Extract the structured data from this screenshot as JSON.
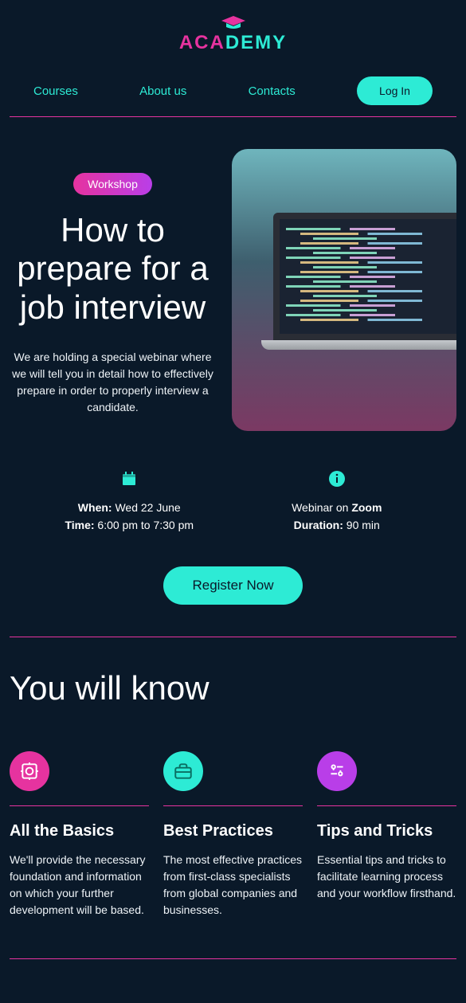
{
  "logo": {
    "left": "ACA",
    "right": "DEMY"
  },
  "nav": {
    "courses": "Courses",
    "about": "About us",
    "contacts": "Contacts",
    "login": "Log In"
  },
  "hero": {
    "badge": "Workshop",
    "title": "How to prepare for a job interview",
    "desc": "We are holding a special webinar where we will tell you in detail how to effectively prepare in order to properly interview a candidate."
  },
  "info": {
    "when_label": "When:",
    "when_value": " Wed 22 June",
    "time_label": "Time:",
    "time_value": " 6:00 pm to 7:30 pm",
    "webinar_prefix": "Webinar on ",
    "webinar_platform": "Zoom",
    "duration_label": "Duration:",
    "duration_value": " 90 min"
  },
  "cta": {
    "register": "Register Now"
  },
  "know": {
    "heading": "You will know",
    "cards": [
      {
        "title": "All the Basics",
        "desc": "We'll provide the necessary foundation and information on which your further development will be based."
      },
      {
        "title": "Best Practices",
        "desc": "The most effective practices from first-class specialists from global companies and businesses."
      },
      {
        "title": "Tips and Tricks",
        "desc": "Essential tips and tricks to facilitate learning process and your workflow firsthand."
      }
    ]
  }
}
